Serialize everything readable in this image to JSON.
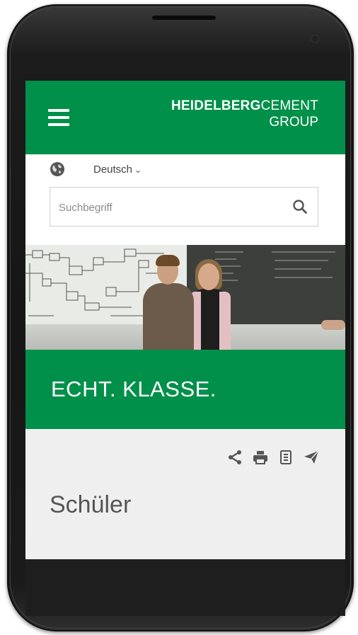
{
  "header": {
    "menu_icon": "hamburger-menu-icon",
    "logo_bold": "HEIDELBERG",
    "logo_regular": "CEMENT",
    "logo_line2": "GROUP"
  },
  "language": {
    "icon": "globe-icon",
    "label": "Deutsch"
  },
  "search": {
    "placeholder": "Suchbegriff",
    "value": "",
    "icon": "search-icon"
  },
  "hero": {
    "description_icon": "students-photo"
  },
  "banner": {
    "title": "ECHT. KLASSE."
  },
  "toolbar": {
    "icons": [
      "share-icon",
      "print-icon",
      "document-icon",
      "send-icon"
    ]
  },
  "page": {
    "title": "Schüler"
  },
  "colors": {
    "brand_green": "#00904a",
    "page_bg": "#efefef",
    "phone_body": "#1c1c1c"
  }
}
